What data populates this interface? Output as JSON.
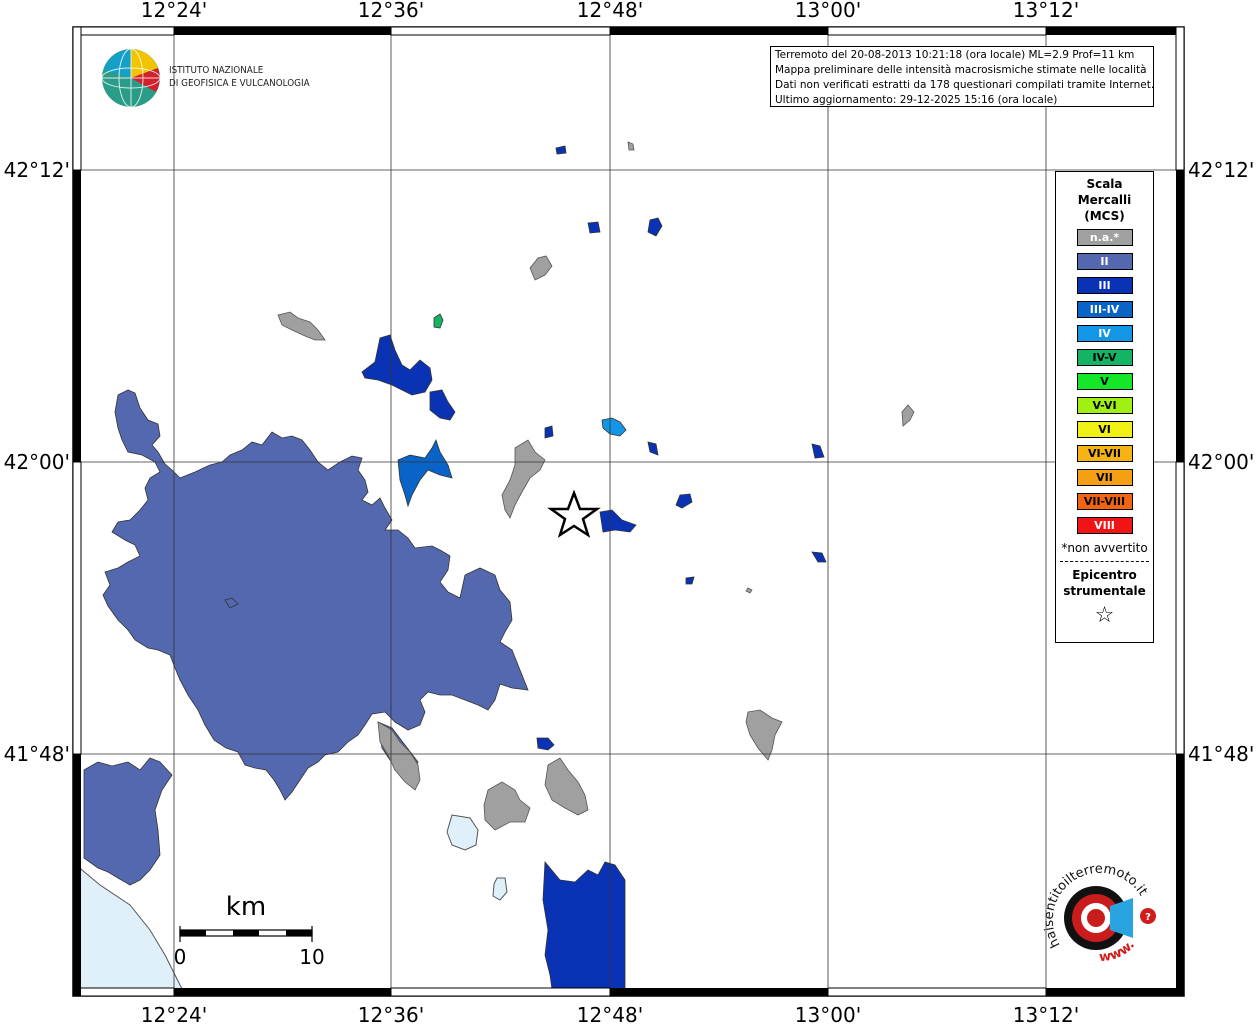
{
  "map": {
    "longitude_labels": [
      "12°24'",
      "12°36'",
      "12°48'",
      "13°00'",
      "13°12'"
    ],
    "latitude_labels": [
      "42°12'",
      "42°00'",
      "41°48'"
    ],
    "epicenter_marker": "star-icon"
  },
  "logo": {
    "line1": "ISTITUTO NAZIONALE",
    "line2": "DI GEOFISICA E VULCANOLOGIA"
  },
  "info": {
    "line1": "Terremoto del 20-08-2013 10:21:18 (ora locale) ML=2.9 Prof=11 km",
    "line2": "Mappa preliminare delle intensità macrosismiche stimate nelle località",
    "line3": "Dati non verificati estratti da 178 questionari compilati tramite Internet.",
    "line4": "Ultimo aggiornamento: 29-12-2025 15:16 (ora locale)"
  },
  "legend": {
    "title1": "Scala",
    "title2": "Mercalli",
    "title3": "(MCS)",
    "items": [
      {
        "label": "n.a.*",
        "color": "#a0a0a0"
      },
      {
        "label": "II",
        "color": "#5468b0"
      },
      {
        "label": "III",
        "color": "#0a32b4"
      },
      {
        "label": "III-IV",
        "color": "#0a64c8"
      },
      {
        "label": "IV",
        "color": "#1496e6"
      },
      {
        "label": "IV-V",
        "color": "#14b464"
      },
      {
        "label": "V",
        "color": "#14e628"
      },
      {
        "label": "V-VI",
        "color": "#a0f014"
      },
      {
        "label": "VI",
        "color": "#f0f014"
      },
      {
        "label": "VI-VII",
        "color": "#f5b414"
      },
      {
        "label": "VII",
        "color": "#f5a014"
      },
      {
        "label": "VII-VIII",
        "color": "#f06414"
      },
      {
        "label": "VIII",
        "color": "#f01414"
      }
    ],
    "note": "*non avvertito",
    "epicenter1": "Epicentro",
    "epicenter2": "strumentale"
  },
  "scale_bar": {
    "unit": "km",
    "start": "0",
    "end": "10"
  },
  "watermark": {
    "text": "haisentitoilterremoto.it",
    "url_text": "www."
  }
}
